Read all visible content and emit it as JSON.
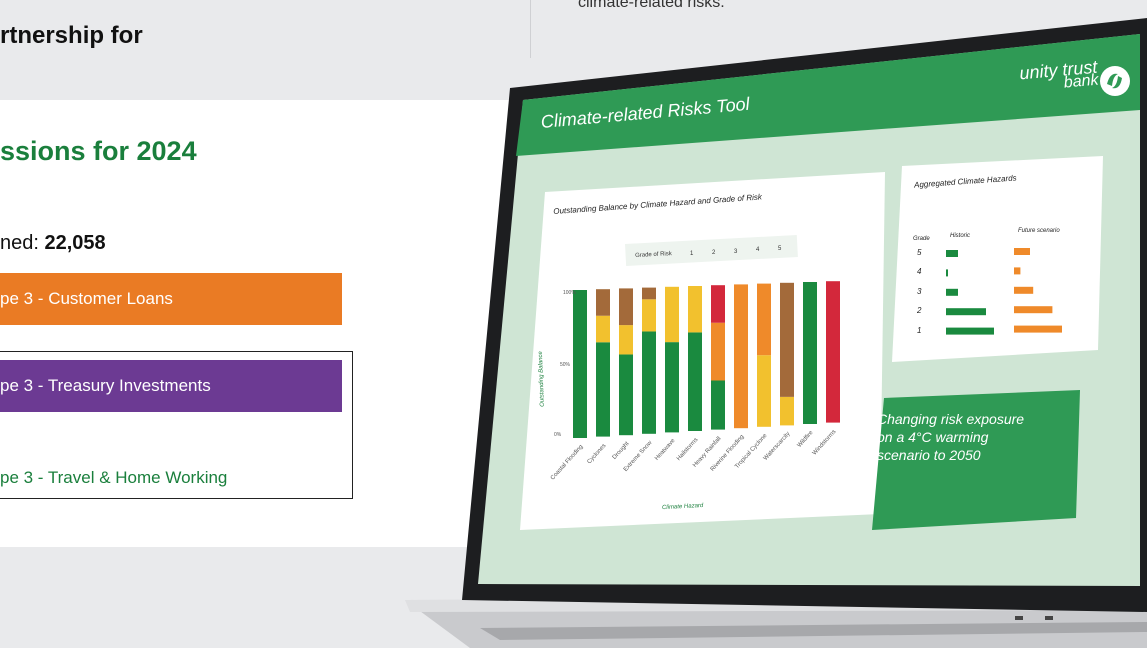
{
  "header": {
    "title_fragment": "rtnership for",
    "right_caption": "climate-related risks."
  },
  "emissions_panel": {
    "heading": "ssions for 2024",
    "total_label": "ned: ",
    "total_value": "22,058",
    "bars": [
      {
        "label": "pe 3 - Customer Loans",
        "color": "#ea7b24"
      },
      {
        "label": "pe 3 - Treasury Investments",
        "color": "#6c3a93"
      },
      {
        "label": "pe 3 - Travel & Home Working",
        "color": "#1a7f3c"
      }
    ]
  },
  "app": {
    "title": "Climate-related Risks Tool",
    "logo_line1": "unity trust",
    "logo_line2": "bank",
    "colors": {
      "brand_green": "#2f9a55",
      "screen_bg": "#cfe5d4"
    }
  },
  "chart_card": {
    "title": "Outstanding Balance by Climate Hazard and Grade of Risk",
    "legend_title": "Grade of Risk",
    "legend_items": [
      "1",
      "2",
      "3",
      "4",
      "5"
    ],
    "y_ticks": [
      "100%",
      "50%",
      "0%"
    ],
    "y_title": "Outstanding Balance",
    "x_title": "Climate Hazard"
  },
  "chart_data": {
    "type": "bar",
    "title": "Outstanding Balance by Climate Hazard and Grade of Risk",
    "xlabel": "Climate Hazard",
    "ylabel": "Outstanding Balance",
    "ylim": [
      0,
      100
    ],
    "categories": [
      "Coastal Flooding",
      "Cyclones",
      "Drought",
      "Extreme Snow",
      "Heatwave",
      "Hailstorms",
      "Heavy Rainfall",
      "Riverine Flooding",
      "Tropical Cyclone",
      "Waterscarcity",
      "Wildfire",
      "Windstorms"
    ],
    "series": [
      {
        "name": "1",
        "color": "#1a8a3f",
        "values": [
          100,
          64,
          55,
          70,
          62,
          68,
          34,
          0,
          0,
          0,
          100,
          0
        ]
      },
      {
        "name": "2",
        "color": "#f2c12e",
        "values": [
          0,
          18,
          20,
          22,
          38,
          32,
          0,
          0,
          50,
          20,
          0,
          0
        ]
      },
      {
        "name": "3",
        "color": "#a36a3a",
        "values": [
          0,
          18,
          25,
          8,
          0,
          0,
          0,
          0,
          0,
          80,
          0,
          0
        ]
      },
      {
        "name": "4",
        "color": "#ef8a2a",
        "values": [
          0,
          0,
          0,
          0,
          0,
          0,
          40,
          100,
          50,
          0,
          0,
          0
        ]
      },
      {
        "name": "5",
        "color": "#d3283b",
        "values": [
          0,
          0,
          0,
          0,
          0,
          0,
          26,
          0,
          0,
          0,
          0,
          100
        ]
      }
    ]
  },
  "hazards_card": {
    "title": "Aggregated Climate Hazards",
    "col_grade": "Grade",
    "col_historic": "Historic",
    "col_future": "Future scenario",
    "grades": [
      "5",
      "4",
      "3",
      "2",
      "1"
    ],
    "historic": [
      0.3,
      0.05,
      0.3,
      1.0,
      1.2
    ],
    "future": [
      0.5,
      0.2,
      0.6,
      1.2,
      1.5
    ]
  },
  "callout": {
    "text": "Changing risk exposure on a 4°C warming scenario to 2050"
  }
}
